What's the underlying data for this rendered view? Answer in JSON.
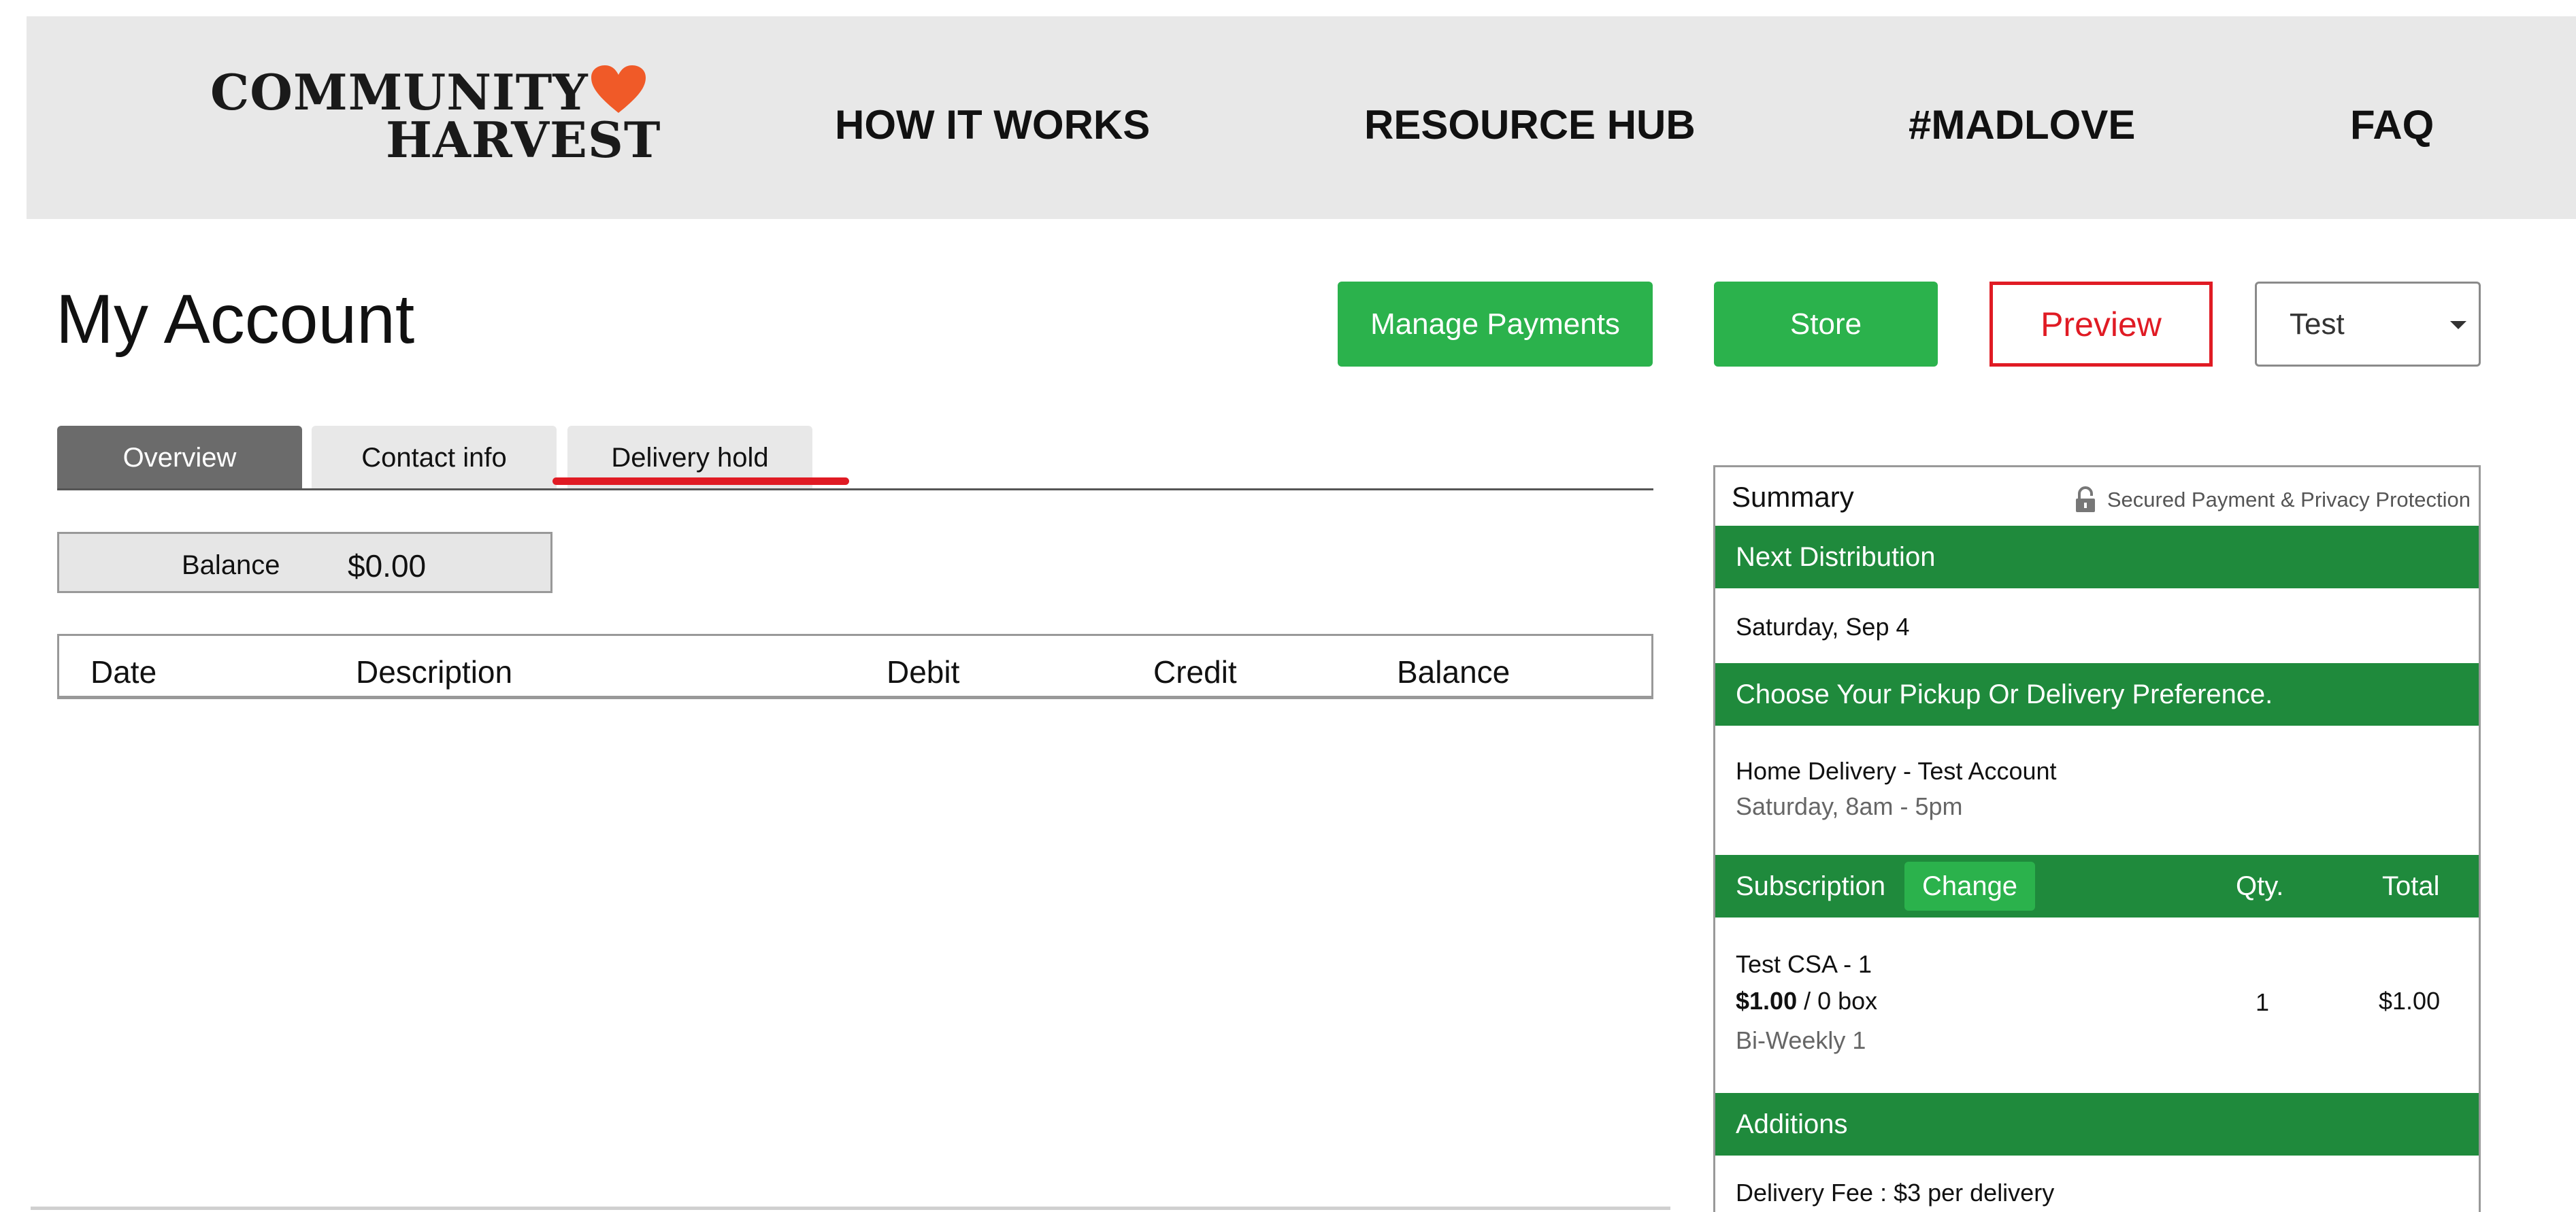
{
  "header": {
    "logo": {
      "line1": "COMMUNITY",
      "line2": "HARVEST",
      "heart_color": "#f05a28"
    },
    "nav": [
      {
        "label": "HOW IT WORKS"
      },
      {
        "label": "RESOURCE HUB"
      },
      {
        "label": "#MADLOVE"
      },
      {
        "label": "FAQ"
      }
    ]
  },
  "page": {
    "title": "My Account",
    "actions": {
      "manage_payments": "Manage Payments",
      "store": "Store",
      "preview": "Preview",
      "account_select": "Test"
    }
  },
  "tabs": [
    {
      "label": "Overview",
      "active": true
    },
    {
      "label": "Contact info",
      "active": false
    },
    {
      "label": "Delivery hold",
      "active": false
    }
  ],
  "balance": {
    "label": "Balance",
    "value": "$0.00"
  },
  "transactions": {
    "columns": [
      "Date",
      "Description",
      "Debit",
      "Credit",
      "Balance"
    ],
    "rows": []
  },
  "summary": {
    "title": "Summary",
    "secure_text": "Secured Payment & Privacy Protection",
    "next_distribution": {
      "heading": "Next Distribution",
      "date": "Saturday, Sep 4"
    },
    "pickup": {
      "heading": "Choose Your Pickup Or Delivery Preference.",
      "option": "Home Delivery - Test Account",
      "window": "Saturday, 8am - 5pm"
    },
    "subscription": {
      "heading": "Subscription",
      "change_label": "Change",
      "qty_header": "Qty.",
      "total_header": "Total",
      "item": {
        "name": "Test CSA - 1",
        "price": "$1.00",
        "unit": " / 0 box",
        "frequency": "Bi-Weekly 1",
        "qty": "1",
        "total": "$1.00"
      }
    },
    "additions": {
      "heading": "Additions",
      "fee": "Delivery Fee : $3 per delivery"
    }
  },
  "colors": {
    "accent_green": "#2bb24c",
    "band_green": "#1f8a3c",
    "preview_red": "#e01b24",
    "header_bg": "#e8e8e8"
  }
}
